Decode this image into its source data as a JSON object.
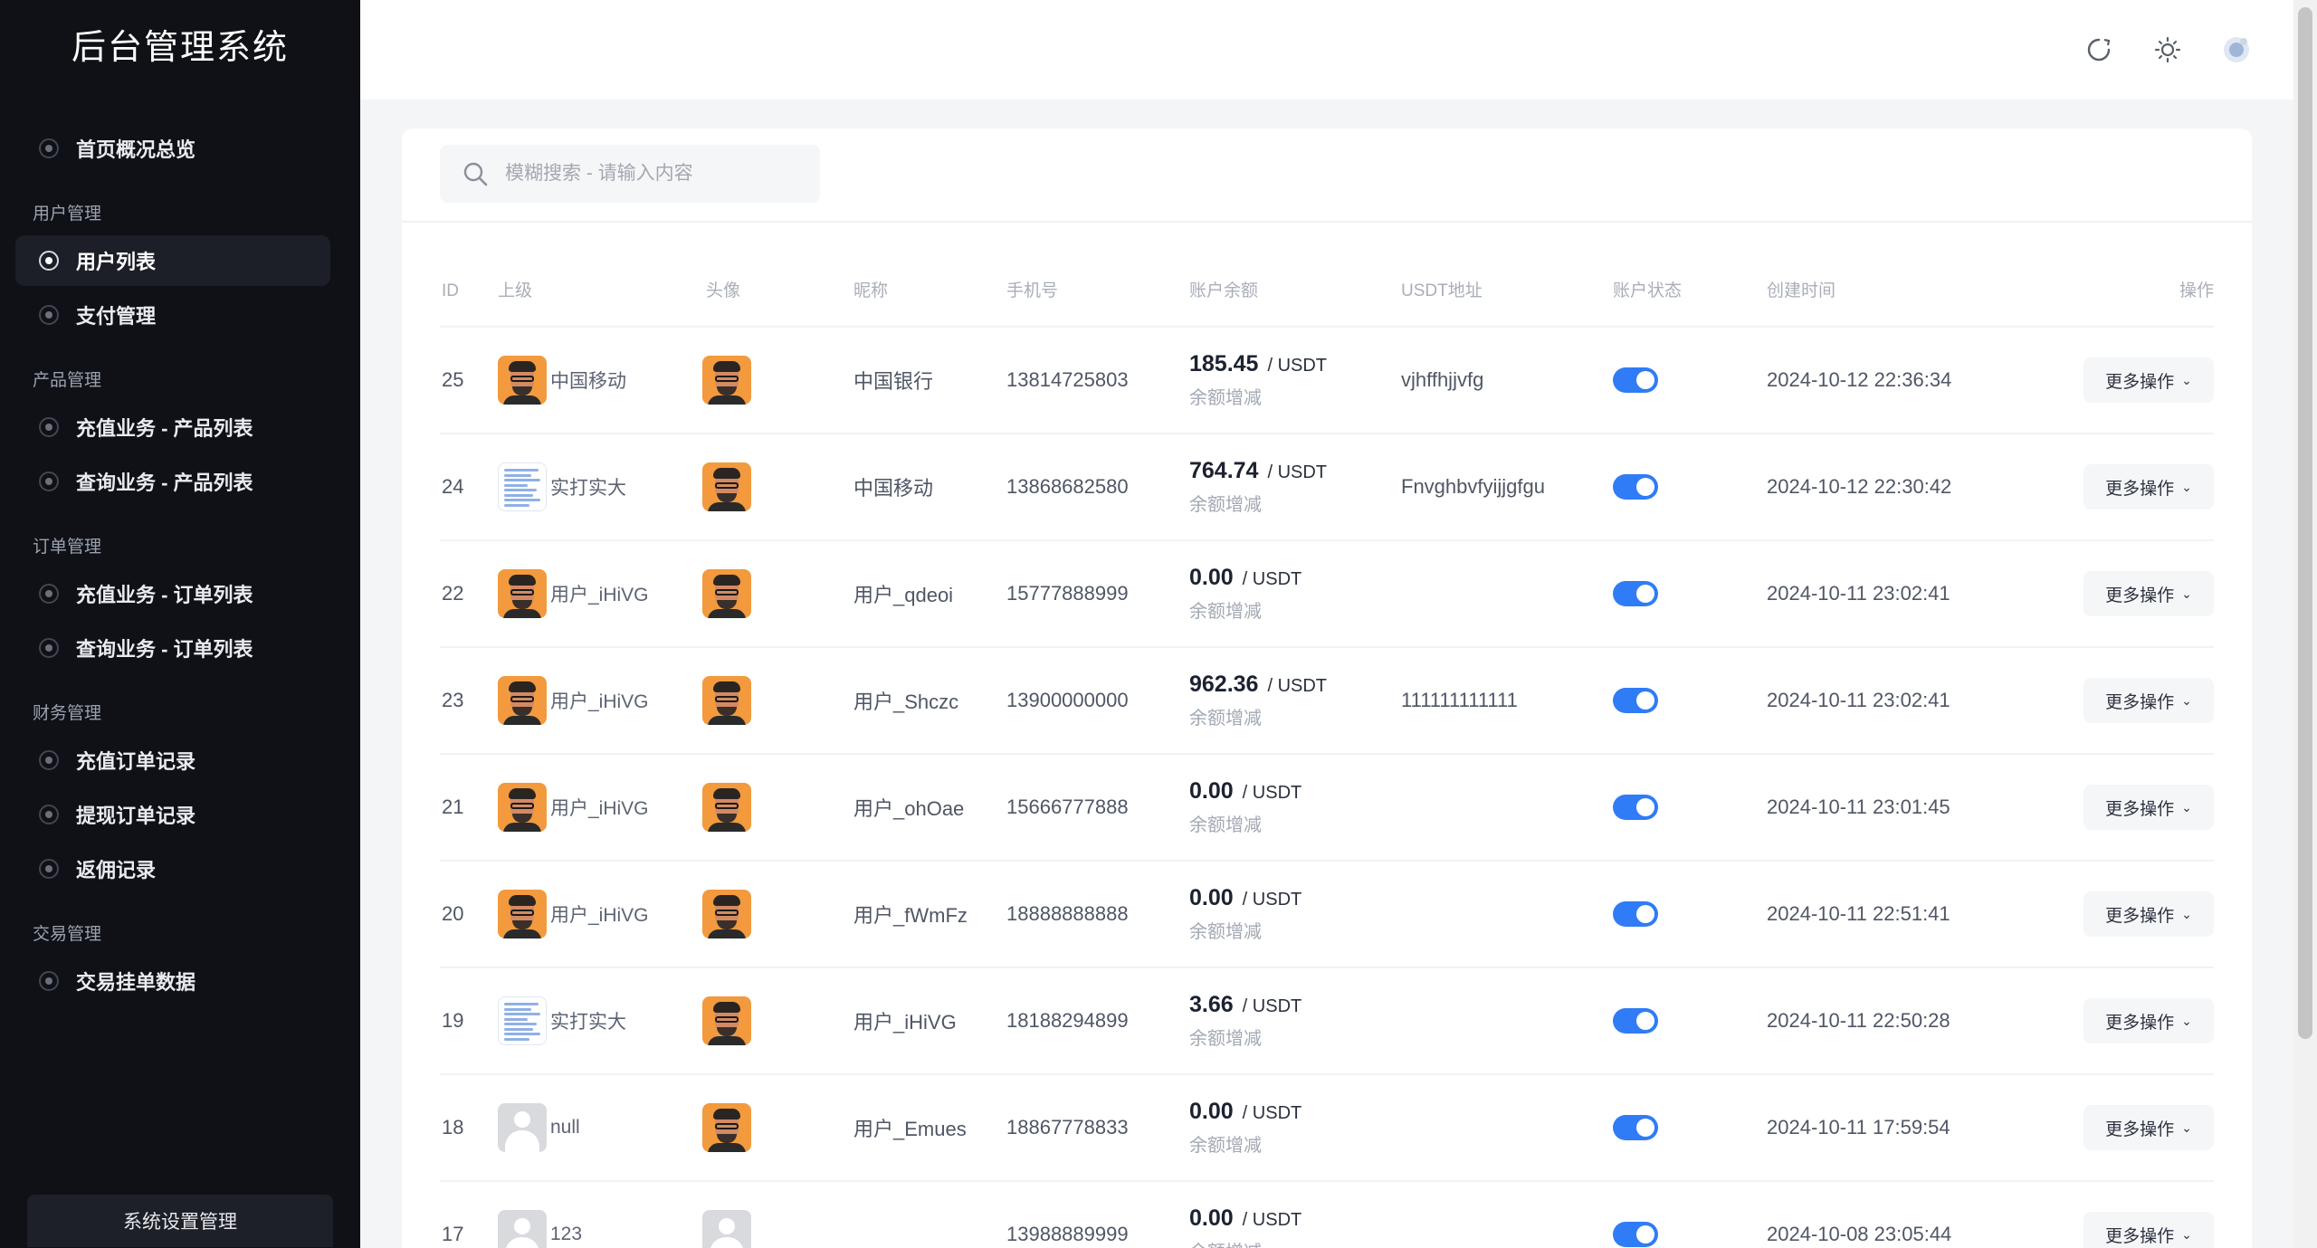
{
  "app": {
    "title": "后台管理系统"
  },
  "sidebar": {
    "top_item": "首页概况总览",
    "groups": [
      {
        "title": "用户管理",
        "items": [
          "用户列表",
          "支付管理"
        ]
      },
      {
        "title": "产品管理",
        "items": [
          "充值业务 - 产品列表",
          "查询业务 - 产品列表"
        ]
      },
      {
        "title": "订单管理",
        "items": [
          "充值业务 - 订单列表",
          "查询业务 - 订单列表"
        ]
      },
      {
        "title": "财务管理",
        "items": [
          "充值订单记录",
          "提现订单记录",
          "返佣记录"
        ]
      },
      {
        "title": "交易管理",
        "items": [
          "交易挂单数据"
        ]
      }
    ],
    "active_item": "用户列表",
    "bottom_button": "系统设置管理"
  },
  "search": {
    "placeholder": "模糊搜索 - 请输入内容"
  },
  "table": {
    "headers": {
      "id": "ID",
      "parent": "上级",
      "avatar": "头像",
      "nickname": "昵称",
      "phone": "手机号",
      "balance": "账户余额",
      "usdt": "USDT地址",
      "status": "账户状态",
      "created": "创建时间",
      "ops": "操作"
    },
    "balance_sub": "余额增减",
    "unit": "/ USDT",
    "ops_label": "更多操作",
    "rows": [
      {
        "id": "25",
        "parent_avatar": "person",
        "parent_name": "中国移动",
        "avatar": "person",
        "nickname": "中国银行",
        "phone": "13814725803",
        "balance": "185.45",
        "usdt": "vjhffhjjvfg",
        "created": "2024-10-12 22:36:34"
      },
      {
        "id": "24",
        "parent_avatar": "doc",
        "parent_name": "实打实大",
        "avatar": "person",
        "nickname": "中国移动",
        "phone": "13868682580",
        "balance": "764.74",
        "usdt": "Fnvghbvfyijjgfgu",
        "created": "2024-10-12 22:30:42"
      },
      {
        "id": "22",
        "parent_avatar": "person",
        "parent_name": "用户_iHiVG",
        "avatar": "person",
        "nickname": "用户_qdeoi",
        "phone": "15777888999",
        "balance": "0.00",
        "usdt": "",
        "created": "2024-10-11 23:02:41"
      },
      {
        "id": "23",
        "parent_avatar": "person",
        "parent_name": "用户_iHiVG",
        "avatar": "person",
        "nickname": "用户_Shczc",
        "phone": "13900000000",
        "balance": "962.36",
        "usdt": "111111111111",
        "created": "2024-10-11 23:02:41"
      },
      {
        "id": "21",
        "parent_avatar": "person",
        "parent_name": "用户_iHiVG",
        "avatar": "person",
        "nickname": "用户_ohOae",
        "phone": "15666777888",
        "balance": "0.00",
        "usdt": "",
        "created": "2024-10-11 23:01:45"
      },
      {
        "id": "20",
        "parent_avatar": "person",
        "parent_name": "用户_iHiVG",
        "avatar": "person",
        "nickname": "用户_fWmFz",
        "phone": "18888888888",
        "balance": "0.00",
        "usdt": "",
        "created": "2024-10-11 22:51:41"
      },
      {
        "id": "19",
        "parent_avatar": "doc",
        "parent_name": "实打实大",
        "avatar": "person",
        "nickname": "用户_iHiVG",
        "phone": "18188294899",
        "balance": "3.66",
        "usdt": "",
        "created": "2024-10-11 22:50:28"
      },
      {
        "id": "18",
        "parent_avatar": "grey",
        "parent_name": "null",
        "avatar": "person",
        "nickname": "用户_Emues",
        "phone": "18867778833",
        "balance": "0.00",
        "usdt": "",
        "created": "2024-10-11 17:59:54"
      },
      {
        "id": "17",
        "parent_avatar": "grey",
        "parent_name": "123",
        "avatar": "grey",
        "nickname": "",
        "phone": "13988889999",
        "balance": "0.00",
        "usdt": "",
        "created": "2024-10-08 23:05:44"
      }
    ]
  },
  "header_icons": [
    "refresh-icon",
    "theme-sun-icon",
    "user-avatar-icon"
  ],
  "colors": {
    "sidebar_bg": "#0f1117",
    "accent": "#2f7cf6",
    "page_bg": "#f4f5f7"
  }
}
